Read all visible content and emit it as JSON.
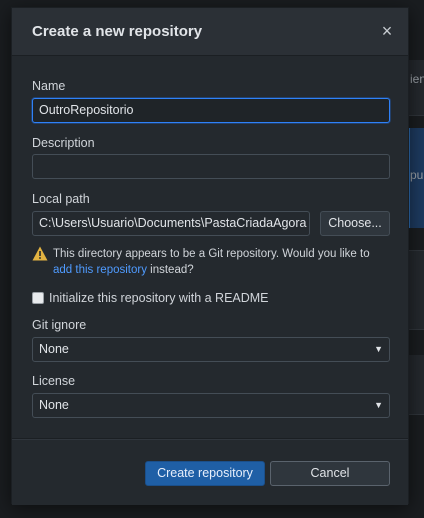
{
  "background": {
    "fragments": [
      "ien",
      "pu"
    ]
  },
  "dialog": {
    "title": "Create a new repository",
    "close_symbol": "×",
    "name_label": "Name",
    "name_value": "OutroRepositorio",
    "description_label": "Description",
    "description_value": "",
    "local_path_label": "Local path",
    "local_path_value": "C:\\Users\\Usuario\\Documents\\PastaCriadaAgora",
    "choose_button": "Choose...",
    "warning_text_before": "This directory appears to be a Git repository. Would you like to ",
    "warning_link": "add this repository",
    "warning_text_after": " instead?",
    "readme_checkbox_label": "Initialize this repository with a README",
    "readme_checked": false,
    "gitignore_label": "Git ignore",
    "gitignore_value": "None",
    "license_label": "License",
    "license_value": "None",
    "create_button": "Create repository",
    "cancel_button": "Cancel"
  },
  "colors": {
    "accent": "#2f81f7",
    "primary_button": "#1f5fa6",
    "link": "#4f9bff",
    "warning_icon": "#e3b341"
  },
  "icons": {
    "warning": "warning-triangle-icon",
    "close": "close-icon",
    "dropdown": "chevron-down-icon"
  }
}
